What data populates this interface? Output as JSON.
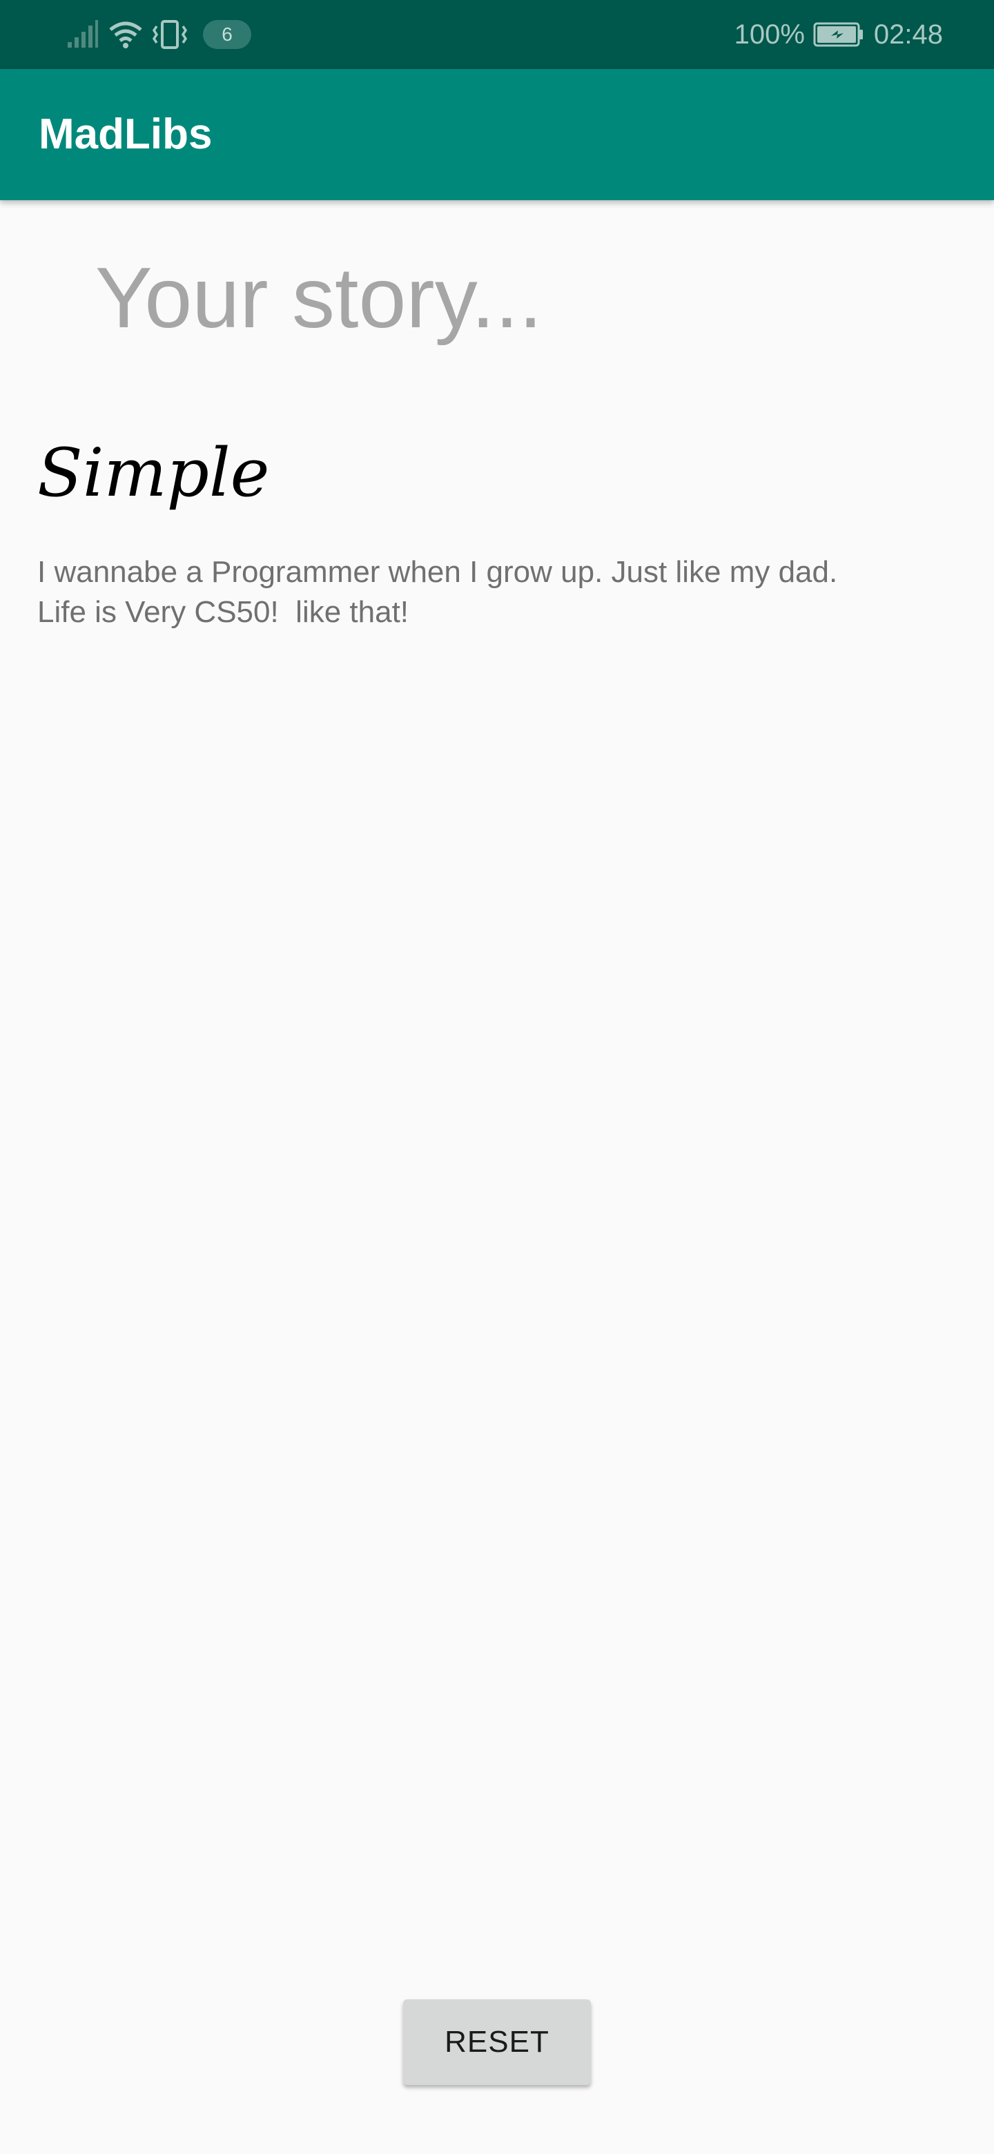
{
  "status_bar": {
    "notification_count": "6",
    "battery_percent": "100%",
    "time": "02:48",
    "icons": [
      "signal-icon",
      "wifi-icon",
      "vibrate-icon",
      "battery-charging-icon"
    ]
  },
  "app_bar": {
    "title": "MadLibs"
  },
  "story": {
    "heading": "Your story...",
    "type_label": "Simple",
    "text_line1": "I wannabe a Programmer when I grow up. Just like my dad.",
    "text_line2": "Life is Very CS50!  like that!"
  },
  "actions": {
    "reset_label": "RESET"
  },
  "colors": {
    "status_bar": "#00574b",
    "app_bar": "#00897b",
    "background": "#fafafa",
    "button": "#d6d7d7"
  }
}
